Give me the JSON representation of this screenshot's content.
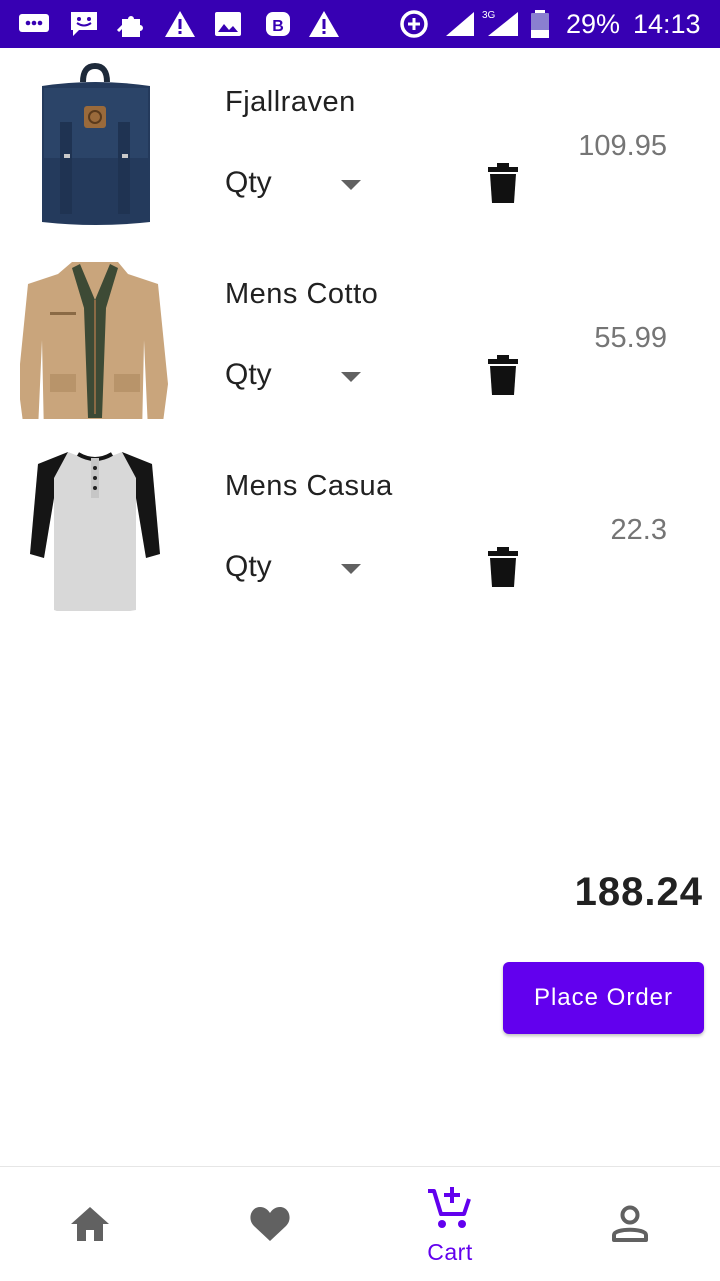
{
  "status_bar": {
    "battery": "29%",
    "time": "14:13",
    "network": "3G",
    "icons": [
      "messages-icon",
      "chat-icon",
      "puzzle-icon",
      "warning-icon",
      "gallery-icon",
      "bixby-icon",
      "warning-icon",
      "data-saver-icon",
      "signal-icon",
      "battery-icon"
    ]
  },
  "cart": {
    "items": [
      {
        "name": "Fjallraven",
        "qty_label": "Qty",
        "price": "109.95",
        "image": "backpack-image"
      },
      {
        "name": "Mens Cotto",
        "qty_label": "Qty",
        "price": "55.99",
        "image": "jacket-image"
      },
      {
        "name": "Mens Casua",
        "qty_label": "Qty",
        "price": "22.3",
        "image": "tshirt-image"
      }
    ],
    "total": "188.24",
    "place_order_label": "Place Order"
  },
  "bottom_nav": {
    "items": [
      {
        "id": "home",
        "icon": "home-icon",
        "label": ""
      },
      {
        "id": "favorites",
        "icon": "heart-icon",
        "label": ""
      },
      {
        "id": "cart",
        "icon": "cart-add-icon",
        "label": "Cart",
        "active": true
      },
      {
        "id": "profile",
        "icon": "person-icon",
        "label": ""
      }
    ]
  },
  "colors": {
    "status_bar": "#3700b3",
    "primary": "#6200ee",
    "inactive_icon": "#616161",
    "price_text": "#757575"
  }
}
